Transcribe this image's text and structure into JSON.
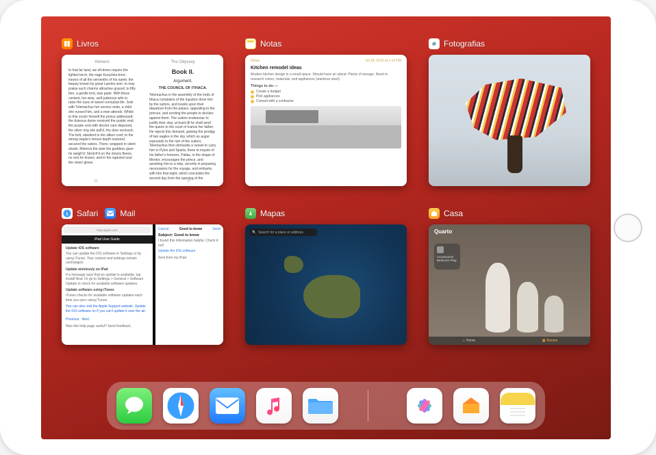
{
  "switcher": {
    "apps": [
      {
        "id": "livros",
        "title": "Livros",
        "book": {
          "left_header": "Homero",
          "right_header": "The Odyssey",
          "book_title": "Book II.",
          "subtitle": "Argument.",
          "council_title": "THE COUNCIL OF ITHACA.",
          "left_text": "In that far land, we oft-times require the lighted torch, the sage Eurycleia bore; ineyes of all the servenths of his name; the beauty known by great Laertes won; to may praise such charms attractive graced; to fifty ben, a gentle lord, was pade. With these content, her wise, well-judicious wife to raise the eyes of sweet connubial life. Sole with Telemachus her service ends, a child she nursed him, and a man attends. Whilst to this couch himself the prince addressed; the duteous dame received the purple vest; the purple vest with decent care disposed, the silver ring she pull'd, the door reclosed. The bolt, obedient to the silken cord; to the strong staple's inmost depth restored, secured the valves. There, wrapped in silent shade, Minerva the wise the goddess gave he weigh'd; Stretch'd on the downy fleece, no rest he knows; and in his raptured soul the vision glows.",
          "right_text": "Telemachus in the assembly of the lords of Ithaca complains of the injustice done him by the suitors, and insists upon their departure from the palace, appealing to the princes, and exciting the people to declare against them. The suitors endeavour to justify their stay, at least till he shall send the queen to the court of Icarius her father. He rejects this demand, gaining the prodigy of two eagles in the sky, which as augur expounds to the ruin of the suitors. Telemachus then demands a vessel to carry him to Pylos and Sparta, there to inquire of his father's fortunes. Pallas, in the shape of Mentor, encourages the prince, and assisting him to a ship, secretly in preparing necessaries for the voyage, and embarks with him that night, which concludes the second day from the opening of the",
          "left_pagenum": "56",
          "right_pagenum": "57"
        }
      },
      {
        "id": "notas",
        "title": "Notas",
        "note": {
          "back_label": "Notas",
          "date": "Jul 18, 2019 at 1:14 PM",
          "heading": "Kitchen remodel ideas",
          "body": "Modern kitchen design in a small space. Should have an island. Plenty of storage. Need to research colors, materials, and appliances (stainless steel).",
          "section": "Things to do —",
          "items": [
            "Create a budget",
            "Pick appliances",
            "Consult with a contractor"
          ]
        }
      },
      {
        "id": "fotografias",
        "title": "Fotografias"
      },
      {
        "id": "safari_mail",
        "title_a": "Safari",
        "title_b": "Mail",
        "safari": {
          "url": "help.apple.com",
          "page_header": "iPad User Guide",
          "article_title": "Update iOS software",
          "line1": "You can update the iOS software in Settings or by using iTunes. Your content and settings remain unchanged.",
          "sub1": "Update wirelessly on iPad",
          "line2": "If a message says that an update is available, tap Install Now. Or go to Settings > General > Software Update to check for available software updates.",
          "sub2": "Update software using iTunes",
          "line3": "iTunes checks for available software updates each time you sync using iTunes.",
          "line4": "You can also visit the Apple Support website: Update the iOS software on if you can't update it over the air.",
          "prev": "Previous",
          "next": "Next",
          "feedback": "Was this help page useful? Send feedback."
        },
        "mail": {
          "cancel": "Cancel",
          "subject_label": "Good to know",
          "send": "Send",
          "greeting": "Subject: Good to know",
          "body": "I found this information helpful. Check it out!",
          "link": "Update the iOS software",
          "signoff": "Sent from my iPad"
        }
      },
      {
        "id": "mapas",
        "title": "Mapas",
        "search_placeholder": "Search for a place or address"
      },
      {
        "id": "casa",
        "title": "Casa",
        "room": "Quarto",
        "tile_sub": "Accessories",
        "tile_name": "Bedroom Plug",
        "tab1": "Home",
        "tab2": "Rooms"
      }
    ]
  },
  "dock": {
    "items": [
      "messages",
      "safari",
      "mail",
      "music",
      "files"
    ],
    "recent": [
      "photos",
      "home",
      "notes"
    ]
  }
}
